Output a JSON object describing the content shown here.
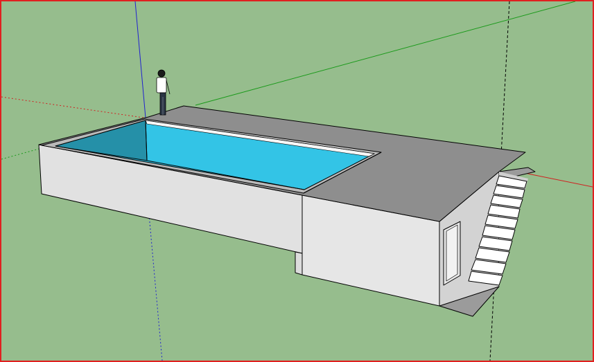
{
  "viewport": {
    "background_color": "#96bd8d",
    "border_color": "#e02020"
  },
  "axes": {
    "red_axis_color": "#d02020",
    "green_axis_color": "#1a9a1a",
    "blue_axis_color": "#2020d0"
  },
  "model": {
    "pool_water_color": "#33c4e6",
    "pool_water_shadow_color": "#2590a8",
    "deck_color": "#8e8e8e",
    "wall_front_color": "#e0e0e0",
    "wall_side_color": "#d3d3d3",
    "stair_tread_color": "#ffffff",
    "stair_riser_color": "#c8c8c8",
    "edge_color": "#000000"
  },
  "scale_figure": {
    "icon": "person-figure-icon",
    "shirt_color": "#ffffff",
    "pants_color": "#2b3645"
  }
}
